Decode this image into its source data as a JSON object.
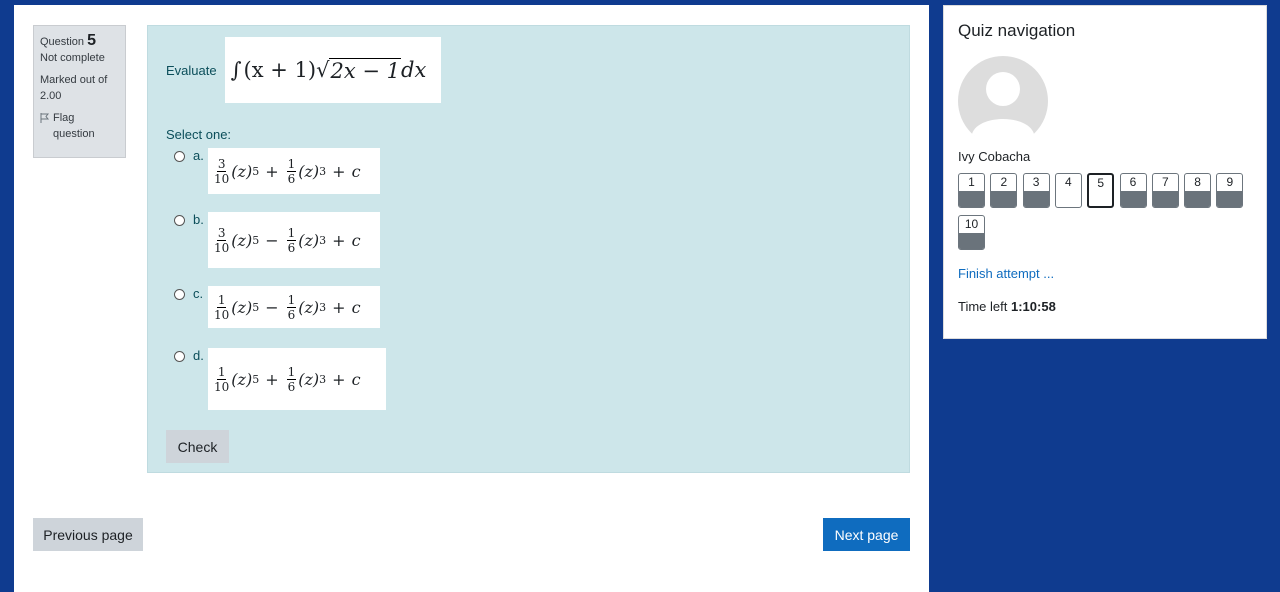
{
  "question": {
    "label": "Question",
    "number": "5",
    "status": "Not complete",
    "marked": "Marked out of 2.00",
    "flag_label": "Flag question"
  },
  "prompt": {
    "evaluate_label": "Evaluate",
    "formula": {
      "integral": "∫",
      "lhs": "(x + 1)",
      "radicand": "2x − 1",
      "tail": "dx"
    }
  },
  "select_one": "Select one:",
  "options": [
    {
      "letter": "a.",
      "c1": {
        "num": "3",
        "den": "10"
      },
      "p1": "5",
      "sign": "+",
      "c2": {
        "num": "1",
        "den": "6"
      },
      "p2": "3",
      "const": "c"
    },
    {
      "letter": "b.",
      "c1": {
        "num": "3",
        "den": "10"
      },
      "p1": "5",
      "sign": "−",
      "c2": {
        "num": "1",
        "den": "6"
      },
      "p2": "3",
      "const": "c"
    },
    {
      "letter": "c.",
      "c1": {
        "num": "1",
        "den": "10"
      },
      "p1": "5",
      "sign": "−",
      "c2": {
        "num": "1",
        "den": "6"
      },
      "p2": "3",
      "const": "c"
    },
    {
      "letter": "d.",
      "c1": {
        "num": "1",
        "den": "10"
      },
      "p1": "5",
      "sign": "+",
      "c2": {
        "num": "1",
        "den": "6"
      },
      "p2": "3",
      "const": "c"
    }
  ],
  "check_label": "Check",
  "prev_label": "Previous page",
  "next_label": "Next page",
  "nav": {
    "title": "Quiz navigation",
    "user_name": "Ivy Cobacha",
    "questions": [
      {
        "label": "1",
        "answered": true,
        "current": false
      },
      {
        "label": "2",
        "answered": true,
        "current": false
      },
      {
        "label": "3",
        "answered": true,
        "current": false
      },
      {
        "label": "4",
        "answered": false,
        "current": false
      },
      {
        "label": "5",
        "answered": false,
        "current": true
      },
      {
        "label": "6",
        "answered": true,
        "current": false
      },
      {
        "label": "7",
        "answered": true,
        "current": false
      },
      {
        "label": "8",
        "answered": true,
        "current": false
      },
      {
        "label": "9",
        "answered": true,
        "current": false
      },
      {
        "label": "10",
        "answered": true,
        "current": false
      }
    ],
    "finish_label": "Finish attempt ...",
    "time_label": "Time left",
    "time_value": "1:10:58"
  },
  "colors": {
    "background": "#0f3b8f",
    "question_bg": "#cde6ea",
    "primary": "#0f6cbf",
    "secondary": "#ced4da"
  }
}
